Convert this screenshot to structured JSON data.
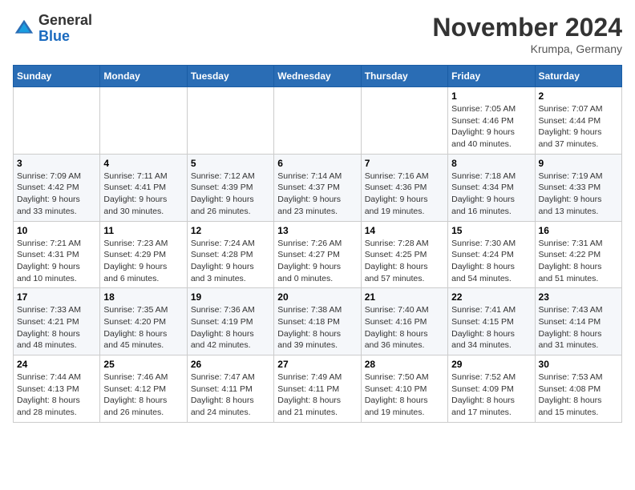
{
  "logo": {
    "general": "General",
    "blue": "Blue"
  },
  "header": {
    "month": "November 2024",
    "location": "Krumpa, Germany"
  },
  "weekdays": [
    "Sunday",
    "Monday",
    "Tuesday",
    "Wednesday",
    "Thursday",
    "Friday",
    "Saturday"
  ],
  "weeks": [
    [
      {
        "day": "",
        "info": ""
      },
      {
        "day": "",
        "info": ""
      },
      {
        "day": "",
        "info": ""
      },
      {
        "day": "",
        "info": ""
      },
      {
        "day": "",
        "info": ""
      },
      {
        "day": "1",
        "info": "Sunrise: 7:05 AM\nSunset: 4:46 PM\nDaylight: 9 hours\nand 40 minutes."
      },
      {
        "day": "2",
        "info": "Sunrise: 7:07 AM\nSunset: 4:44 PM\nDaylight: 9 hours\nand 37 minutes."
      }
    ],
    [
      {
        "day": "3",
        "info": "Sunrise: 7:09 AM\nSunset: 4:42 PM\nDaylight: 9 hours\nand 33 minutes."
      },
      {
        "day": "4",
        "info": "Sunrise: 7:11 AM\nSunset: 4:41 PM\nDaylight: 9 hours\nand 30 minutes."
      },
      {
        "day": "5",
        "info": "Sunrise: 7:12 AM\nSunset: 4:39 PM\nDaylight: 9 hours\nand 26 minutes."
      },
      {
        "day": "6",
        "info": "Sunrise: 7:14 AM\nSunset: 4:37 PM\nDaylight: 9 hours\nand 23 minutes."
      },
      {
        "day": "7",
        "info": "Sunrise: 7:16 AM\nSunset: 4:36 PM\nDaylight: 9 hours\nand 19 minutes."
      },
      {
        "day": "8",
        "info": "Sunrise: 7:18 AM\nSunset: 4:34 PM\nDaylight: 9 hours\nand 16 minutes."
      },
      {
        "day": "9",
        "info": "Sunrise: 7:19 AM\nSunset: 4:33 PM\nDaylight: 9 hours\nand 13 minutes."
      }
    ],
    [
      {
        "day": "10",
        "info": "Sunrise: 7:21 AM\nSunset: 4:31 PM\nDaylight: 9 hours\nand 10 minutes."
      },
      {
        "day": "11",
        "info": "Sunrise: 7:23 AM\nSunset: 4:29 PM\nDaylight: 9 hours\nand 6 minutes."
      },
      {
        "day": "12",
        "info": "Sunrise: 7:24 AM\nSunset: 4:28 PM\nDaylight: 9 hours\nand 3 minutes."
      },
      {
        "day": "13",
        "info": "Sunrise: 7:26 AM\nSunset: 4:27 PM\nDaylight: 9 hours\nand 0 minutes."
      },
      {
        "day": "14",
        "info": "Sunrise: 7:28 AM\nSunset: 4:25 PM\nDaylight: 8 hours\nand 57 minutes."
      },
      {
        "day": "15",
        "info": "Sunrise: 7:30 AM\nSunset: 4:24 PM\nDaylight: 8 hours\nand 54 minutes."
      },
      {
        "day": "16",
        "info": "Sunrise: 7:31 AM\nSunset: 4:22 PM\nDaylight: 8 hours\nand 51 minutes."
      }
    ],
    [
      {
        "day": "17",
        "info": "Sunrise: 7:33 AM\nSunset: 4:21 PM\nDaylight: 8 hours\nand 48 minutes."
      },
      {
        "day": "18",
        "info": "Sunrise: 7:35 AM\nSunset: 4:20 PM\nDaylight: 8 hours\nand 45 minutes."
      },
      {
        "day": "19",
        "info": "Sunrise: 7:36 AM\nSunset: 4:19 PM\nDaylight: 8 hours\nand 42 minutes."
      },
      {
        "day": "20",
        "info": "Sunrise: 7:38 AM\nSunset: 4:18 PM\nDaylight: 8 hours\nand 39 minutes."
      },
      {
        "day": "21",
        "info": "Sunrise: 7:40 AM\nSunset: 4:16 PM\nDaylight: 8 hours\nand 36 minutes."
      },
      {
        "day": "22",
        "info": "Sunrise: 7:41 AM\nSunset: 4:15 PM\nDaylight: 8 hours\nand 34 minutes."
      },
      {
        "day": "23",
        "info": "Sunrise: 7:43 AM\nSunset: 4:14 PM\nDaylight: 8 hours\nand 31 minutes."
      }
    ],
    [
      {
        "day": "24",
        "info": "Sunrise: 7:44 AM\nSunset: 4:13 PM\nDaylight: 8 hours\nand 28 minutes."
      },
      {
        "day": "25",
        "info": "Sunrise: 7:46 AM\nSunset: 4:12 PM\nDaylight: 8 hours\nand 26 minutes."
      },
      {
        "day": "26",
        "info": "Sunrise: 7:47 AM\nSunset: 4:11 PM\nDaylight: 8 hours\nand 24 minutes."
      },
      {
        "day": "27",
        "info": "Sunrise: 7:49 AM\nSunset: 4:11 PM\nDaylight: 8 hours\nand 21 minutes."
      },
      {
        "day": "28",
        "info": "Sunrise: 7:50 AM\nSunset: 4:10 PM\nDaylight: 8 hours\nand 19 minutes."
      },
      {
        "day": "29",
        "info": "Sunrise: 7:52 AM\nSunset: 4:09 PM\nDaylight: 8 hours\nand 17 minutes."
      },
      {
        "day": "30",
        "info": "Sunrise: 7:53 AM\nSunset: 4:08 PM\nDaylight: 8 hours\nand 15 minutes."
      }
    ]
  ]
}
